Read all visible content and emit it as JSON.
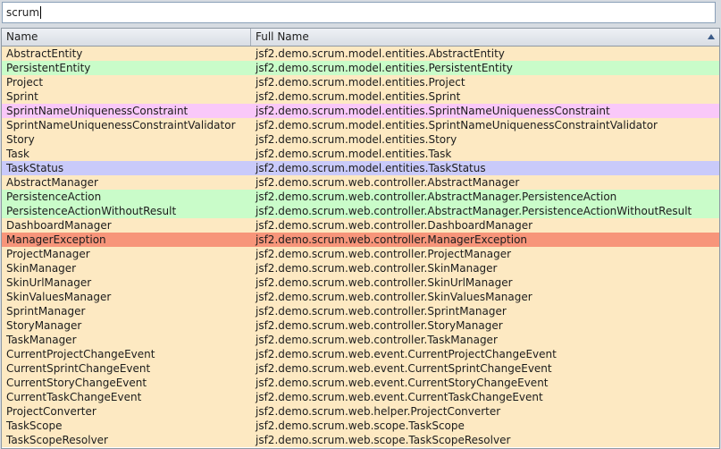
{
  "search": {
    "value": "scrum"
  },
  "columns": {
    "name": "Name",
    "full_name": "Full Name"
  },
  "colors": {
    "default": "#fde9c2",
    "green": "#c9fcc9",
    "pink": "#f9c8f9",
    "blue": "#c9cafa",
    "red": "#f7957a"
  },
  "rows": [
    {
      "name": "AbstractEntity",
      "full": "jsf2.demo.scrum.model.entities.AbstractEntity",
      "color": "default"
    },
    {
      "name": "PersistentEntity",
      "full": "jsf2.demo.scrum.model.entities.PersistentEntity",
      "color": "green"
    },
    {
      "name": "Project",
      "full": "jsf2.demo.scrum.model.entities.Project",
      "color": "default"
    },
    {
      "name": "Sprint",
      "full": "jsf2.demo.scrum.model.entities.Sprint",
      "color": "default"
    },
    {
      "name": "SprintNameUniquenessConstraint",
      "full": "jsf2.demo.scrum.model.entities.SprintNameUniquenessConstraint",
      "color": "pink"
    },
    {
      "name": "SprintNameUniquenessConstraintValidator",
      "full": "jsf2.demo.scrum.model.entities.SprintNameUniquenessConstraintValidator",
      "color": "default"
    },
    {
      "name": "Story",
      "full": "jsf2.demo.scrum.model.entities.Story",
      "color": "default"
    },
    {
      "name": "Task",
      "full": "jsf2.demo.scrum.model.entities.Task",
      "color": "default"
    },
    {
      "name": "TaskStatus",
      "full": "jsf2.demo.scrum.model.entities.TaskStatus",
      "color": "blue"
    },
    {
      "name": "AbstractManager",
      "full": "jsf2.demo.scrum.web.controller.AbstractManager",
      "color": "default"
    },
    {
      "name": "PersistenceAction",
      "full": "jsf2.demo.scrum.web.controller.AbstractManager.PersistenceAction",
      "color": "green"
    },
    {
      "name": "PersistenceActionWithoutResult",
      "full": "jsf2.demo.scrum.web.controller.AbstractManager.PersistenceActionWithoutResult",
      "color": "green"
    },
    {
      "name": "DashboardManager",
      "full": "jsf2.demo.scrum.web.controller.DashboardManager",
      "color": "default"
    },
    {
      "name": "ManagerException",
      "full": "jsf2.demo.scrum.web.controller.ManagerException",
      "color": "red"
    },
    {
      "name": "ProjectManager",
      "full": "jsf2.demo.scrum.web.controller.ProjectManager",
      "color": "default"
    },
    {
      "name": "SkinManager",
      "full": "jsf2.demo.scrum.web.controller.SkinManager",
      "color": "default"
    },
    {
      "name": "SkinUrlManager",
      "full": "jsf2.demo.scrum.web.controller.SkinUrlManager",
      "color": "default"
    },
    {
      "name": "SkinValuesManager",
      "full": "jsf2.demo.scrum.web.controller.SkinValuesManager",
      "color": "default"
    },
    {
      "name": "SprintManager",
      "full": "jsf2.demo.scrum.web.controller.SprintManager",
      "color": "default"
    },
    {
      "name": "StoryManager",
      "full": "jsf2.demo.scrum.web.controller.StoryManager",
      "color": "default"
    },
    {
      "name": "TaskManager",
      "full": "jsf2.demo.scrum.web.controller.TaskManager",
      "color": "default"
    },
    {
      "name": "CurrentProjectChangeEvent",
      "full": "jsf2.demo.scrum.web.event.CurrentProjectChangeEvent",
      "color": "default"
    },
    {
      "name": "CurrentSprintChangeEvent",
      "full": "jsf2.demo.scrum.web.event.CurrentSprintChangeEvent",
      "color": "default"
    },
    {
      "name": "CurrentStoryChangeEvent",
      "full": "jsf2.demo.scrum.web.event.CurrentStoryChangeEvent",
      "color": "default"
    },
    {
      "name": "CurrentTaskChangeEvent",
      "full": "jsf2.demo.scrum.web.event.CurrentTaskChangeEvent",
      "color": "default"
    },
    {
      "name": "ProjectConverter",
      "full": "jsf2.demo.scrum.web.helper.ProjectConverter",
      "color": "default"
    },
    {
      "name": "TaskScope",
      "full": "jsf2.demo.scrum.web.scope.TaskScope",
      "color": "default"
    },
    {
      "name": "TaskScopeResolver",
      "full": "jsf2.demo.scrum.web.scope.TaskScopeResolver",
      "color": "default"
    }
  ]
}
